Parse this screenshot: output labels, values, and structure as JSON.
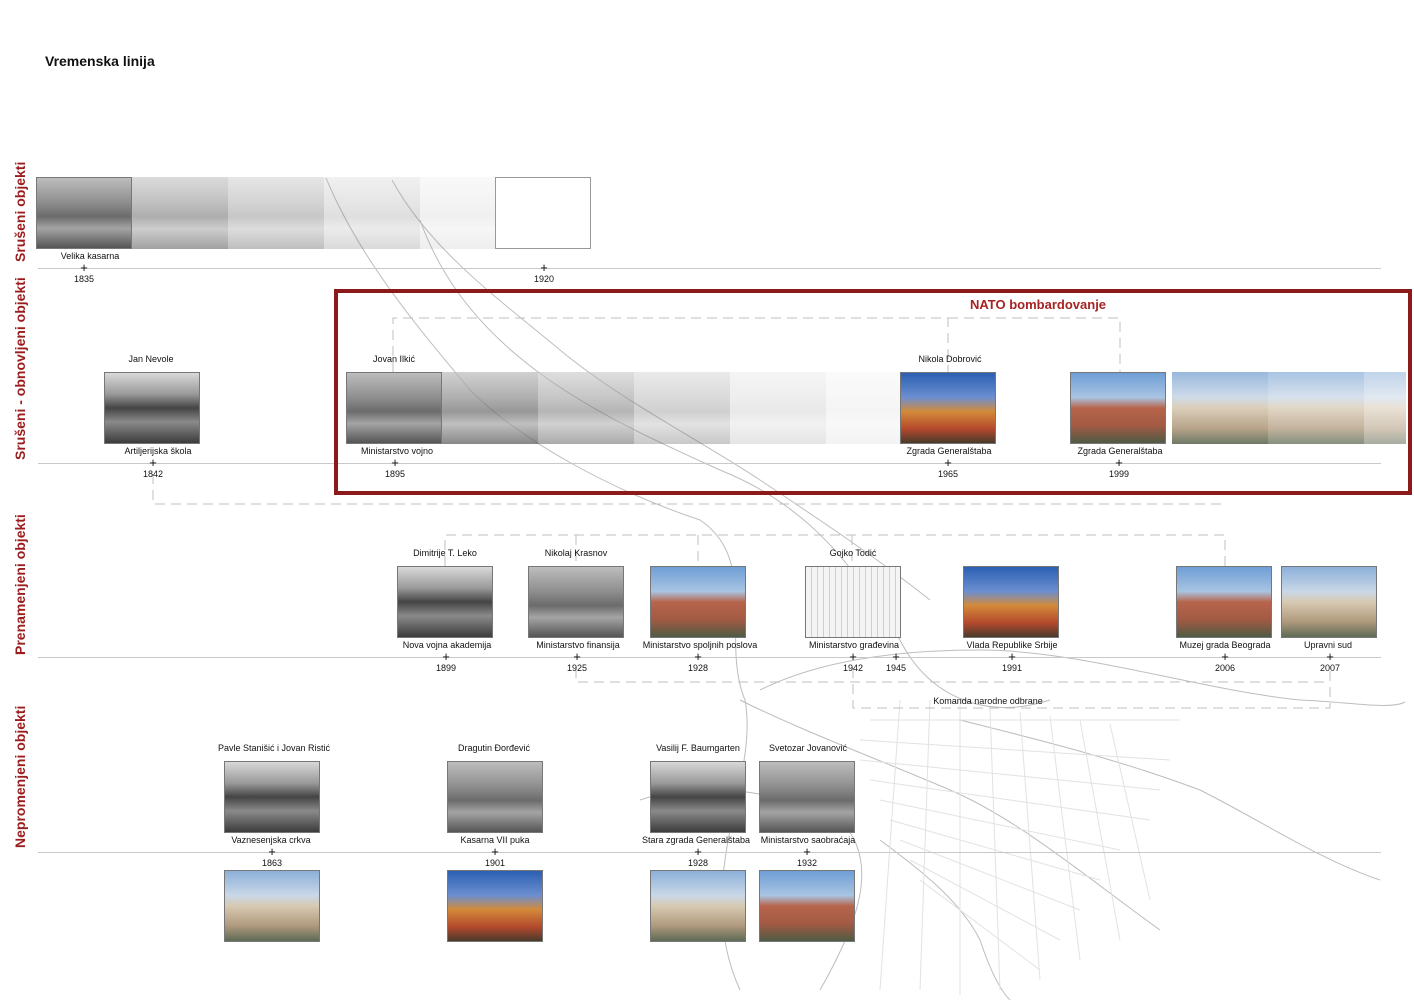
{
  "title": "Vremenska linija",
  "rows": {
    "row1": "Srušeni objekti",
    "row2": "Srušeni - obnovljeni objekti",
    "row3": "Prenamenjeni objekti",
    "row4": "Nepromenjeni objekti"
  },
  "nato": "NATO bombardovanje",
  "srus": {
    "building": "Velika kasarna",
    "y1": "1835",
    "y2": "1920"
  },
  "obn": {
    "a_arch": "Jan Nevole",
    "a_name": "Artiljerijska škola",
    "a_year": "1842",
    "b_arch": "Jovan Ilkić",
    "b_name": "Ministarstvo vojno",
    "b_year": "1895",
    "c_arch": "Nikola Dobrović",
    "c_name": "Zgrada Generalštaba",
    "c_year": "1965",
    "d_name": "Zgrada Generalštaba",
    "d_year": "1999"
  },
  "pren": {
    "a_arch": "Dimitrije T. Leko",
    "a_name": "Nova vojna akademija",
    "a_year": "1899",
    "b_arch": "Nikolaj Krasnov",
    "b_name": "Ministarstvo finansija",
    "b_year": "1925",
    "c_name": "Ministarstvo spoljnih poslova",
    "c_year": "1928",
    "d_arch": "Gojko Todić",
    "d_name": "Ministarstvo građevina",
    "d_year": "1942",
    "e_year": "1945",
    "f_name": "Vlada Republike Srbije",
    "f_year": "1991",
    "g_name": "Muzej grada Beograda",
    "g_year": "2006",
    "h_name": "Upravni sud",
    "h_year": "2007",
    "komanda": "Komanda narodne odbrane"
  },
  "nepr": {
    "a_arch": "Pavle Stanišić i Jovan Ristić",
    "a_name": "Vaznesenjska crkva",
    "a_year": "1863",
    "b_arch": "Dragutin Đorđević",
    "b_name": "Kasarna VII puka",
    "b_year": "1901",
    "c_arch": "Vasilij F. Baumgarten",
    "c_name": "Stara zgrada Generalštaba",
    "c_year": "1928",
    "d_arch": "Svetozar Jovanović",
    "d_name": "Ministarstvo saobraćaja",
    "d_year": "1932"
  },
  "tick": "+"
}
